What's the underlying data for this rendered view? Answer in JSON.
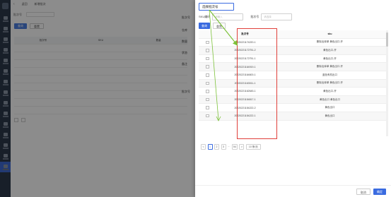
{
  "background_page": {
    "nav_items": 14,
    "topbar": {
      "back_label": "返回",
      "tab_label": "新增批次"
    },
    "search_label": "批次号",
    "buttons": {
      "query": "查询",
      "reset": "重置"
    },
    "table_headers": [
      "批次号",
      "SKU",
      "数量"
    ],
    "side_labels": [
      "批次号",
      "仓库",
      "数量",
      "状态",
      "备注",
      "批次号"
    ]
  },
  "drawer": {
    "title": "选择批次号",
    "filters": [
      {
        "label": "SKU编码",
        "placeholder": "请输入"
      },
      {
        "label": "批次号",
        "placeholder": "请选择"
      }
    ],
    "buttons": {
      "query": "查询",
      "reset": "重置"
    },
    "table": {
      "headers": {
        "batch": "批次号",
        "sku": "sku"
      },
      "rows": [
        {
          "batch": "20220221174220-1",
          "sku": "删除出库单 黄色出口-开"
        },
        {
          "batch": "20220221172751-2",
          "sku": "黄色出口-开"
        },
        {
          "batch": "20220221172751-1",
          "sku": "黄色出口-开"
        },
        {
          "batch": "20220221164919-1",
          "sku": "删除出库单 黄色出口-开"
        },
        {
          "batch": "20220221164600-1",
          "sku": "蓝色有机出口"
        },
        {
          "batch": "20220221163011-1",
          "sku": "删除出库单 黄色出口-开"
        },
        {
          "batch": "20220221162645-1",
          "sku": "黄色出口-开"
        },
        {
          "batch": "20220221154817-1",
          "sku": "黄色出口 黄色出口"
        },
        {
          "batch": "20220221154222-2",
          "sku": "黄色出口"
        },
        {
          "batch": "20220221154222-1",
          "sku": "黄色出口"
        }
      ]
    },
    "pagination": {
      "prev": "<",
      "pages": [
        "1",
        "2",
        "3"
      ],
      "ellipsis": "···",
      "last": "54",
      "next": ">",
      "page_size": "10 条/页"
    },
    "footer": {
      "cancel": "取消",
      "confirm": "确定"
    }
  },
  "colors": {
    "primary": "#3a6be0",
    "highlight": "#e0403a",
    "arrow": "#7dc23a",
    "nav_bg": "#2d3a4b"
  }
}
